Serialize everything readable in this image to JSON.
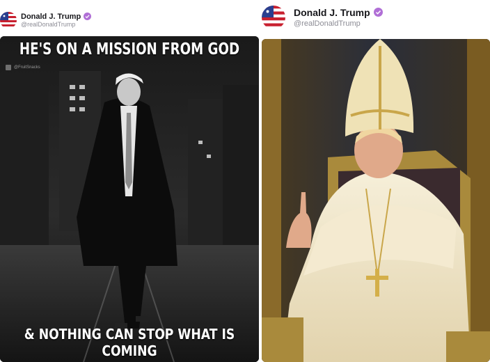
{
  "posts": [
    {
      "author": {
        "display_name": "Donald J. Trump",
        "handle": "@realDonaldTrump",
        "avatar_icon": "flag-avatar-icon",
        "verified_icon": "verified-badge-icon",
        "verified_color": "#b06fd6"
      },
      "media": {
        "top_caption": "HE'S ON A MISSION FROM GOD",
        "bottom_caption": "& NOTHING CAN STOP WHAT IS COMING",
        "watermark": "@FruitSnacks"
      }
    },
    {
      "author": {
        "display_name": "Donald J. Trump",
        "handle": "@realDonaldTrump",
        "avatar_icon": "flag-avatar-icon",
        "verified_icon": "verified-badge-icon",
        "verified_color": "#b06fd6"
      },
      "media": {
        "subject": "pope-portrait-image"
      }
    }
  ]
}
